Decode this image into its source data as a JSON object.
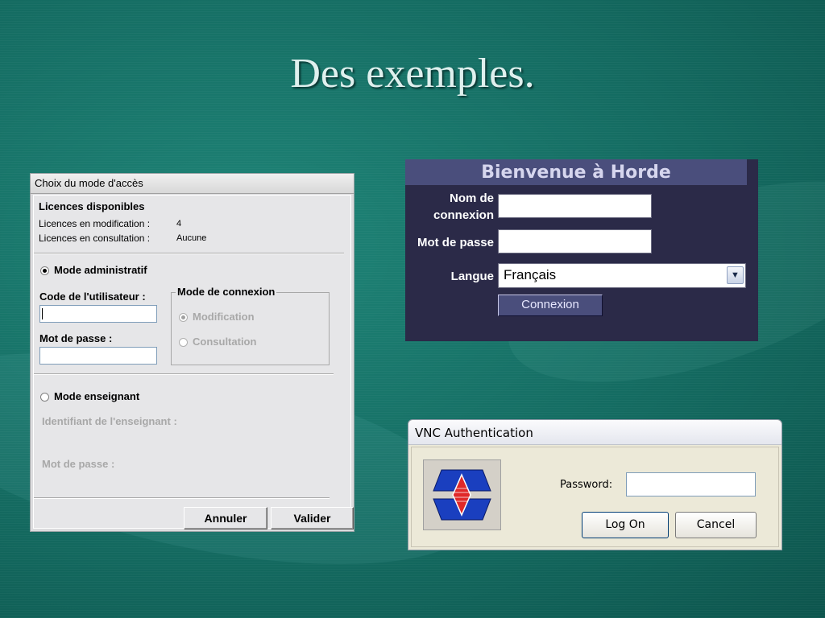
{
  "slide": {
    "title": "Des exemples."
  },
  "dialog_acces": {
    "window_title": "Choix du mode d'accès",
    "licences_heading": "Licences disponibles",
    "licences_modif_label": "Licences en modification :",
    "licences_modif_value": "4",
    "licences_consult_label": "Licences en consultation :",
    "licences_consult_value": "Aucune",
    "mode_admin_label": "Mode administratif",
    "mode_admin_selected": true,
    "code_utilisateur_label": "Code de l'utilisateur :",
    "code_utilisateur_value": "",
    "mot_de_passe_label": "Mot de passe :",
    "mot_de_passe_value": "",
    "mode_connexion_group": "Mode de connexion",
    "modification_label": "Modification",
    "consultation_label": "Consultation",
    "mode_enseignant_label": "Mode enseignant",
    "identifiant_enseignant_label": "Identifiant de l'enseignant :",
    "mot_de_passe_enseignant_label": "Mot de passe :",
    "annuler_label": "Annuler",
    "valider_label": "Valider"
  },
  "horde": {
    "header": "Bienvenue à Horde",
    "nom_label_line1": "Nom de",
    "nom_label_line2": "connexion",
    "mot_de_passe_label": "Mot de passe",
    "langue_label": "Langue",
    "langue_value": "Français",
    "connexion_button": "Connexion",
    "colors": {
      "background": "#2b2a48",
      "header": "#4a4e7c"
    }
  },
  "vnc": {
    "window_title": "VNC Authentication",
    "password_label": "Password:",
    "password_value": "",
    "logon_label": "Log On",
    "cancel_label": "Cancel",
    "logo_icon": "vnc-logo-icon"
  },
  "colors": {
    "background": "#146b61",
    "title": "#dff0ee"
  }
}
